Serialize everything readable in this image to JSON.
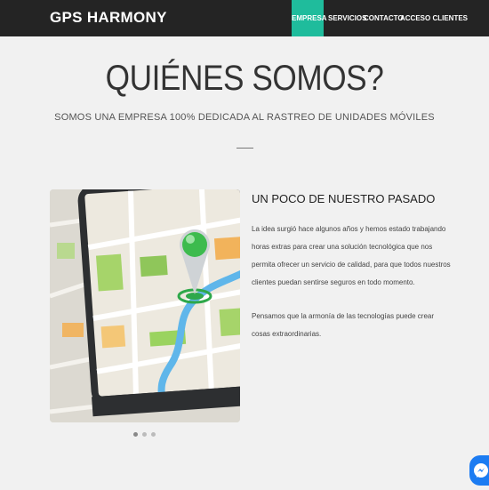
{
  "brand": "GPS HARMONY",
  "nav": {
    "items": [
      {
        "label": "EMPRESA",
        "active": true
      },
      {
        "label": "SERVICIOS",
        "active": false
      },
      {
        "label": "CONTACTO",
        "active": false
      },
      {
        "label": "ACCESO CLIENTES",
        "active": false
      }
    ]
  },
  "hero": {
    "title": "QUIÉNES SOMOS?",
    "subtitle": "SOMOS UNA EMPRESA 100% DEDICADA AL RASTREO DE UNIDADES MÓVILES"
  },
  "about": {
    "title": "UN POCO DE NUESTRO PASADO",
    "paragraphs": [
      "La idea surgió hace algunos años y hemos estado trabajando horas extras para crear una solución tecnológica que nos permita ofrecer un servicio de calidad, para que todos nuestros clientes puedan sentirse seguros en todo momento.",
      "Pensamos que la armonía de las tecnologías puede crear cosas extraordinarias."
    ]
  },
  "carousel": {
    "slides": 3,
    "active_index": 0
  },
  "colors": {
    "accent": "#1fbc9c",
    "navbar": "#242424",
    "background": "#f1f1f1",
    "messenger": "#1c7cf2"
  },
  "icons": {
    "messenger": "messenger-icon",
    "map_pin": "map-pin-icon"
  }
}
